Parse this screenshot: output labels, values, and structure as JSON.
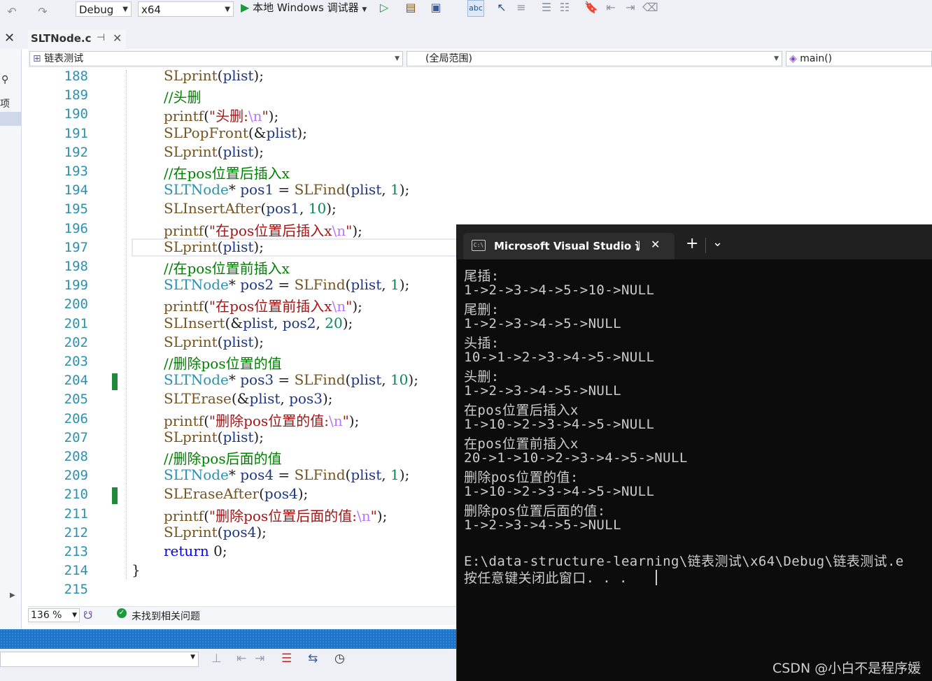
{
  "toolbar": {
    "config": "Debug",
    "platform": "x64",
    "run_label": "本地 Windows 调试器"
  },
  "tab": {
    "file": "SLTNode.c",
    "pin_glyph": "⊣",
    "close_glyph": "✕"
  },
  "side": {
    "close_glyph": "✕",
    "search_glyph": "⚲",
    "text": "项目,"
  },
  "navbar": {
    "project": "链表测试",
    "scope": "(全局范围)",
    "member": "main()"
  },
  "editor": {
    "lines": [
      {
        "num": "188",
        "code": [
          {
            "t": "SLprint",
            "c": "fn"
          },
          {
            "t": "(",
            "c": ""
          },
          {
            "t": "plist",
            "c": "var"
          },
          {
            "t": ");",
            "c": ""
          }
        ]
      },
      {
        "num": "189",
        "code": [
          {
            "t": "//头删",
            "c": "cm"
          }
        ]
      },
      {
        "num": "190",
        "code": [
          {
            "t": "printf",
            "c": "fn"
          },
          {
            "t": "(",
            "c": ""
          },
          {
            "t": "\"头删:",
            "c": "st"
          },
          {
            "t": "\\n",
            "c": "esc"
          },
          {
            "t": "\"",
            "c": "st"
          },
          {
            "t": ");",
            "c": ""
          }
        ]
      },
      {
        "num": "191",
        "code": [
          {
            "t": "SLPopFront",
            "c": "fn"
          },
          {
            "t": "(&",
            "c": ""
          },
          {
            "t": "plist",
            "c": "var"
          },
          {
            "t": ");",
            "c": ""
          }
        ]
      },
      {
        "num": "192",
        "code": [
          {
            "t": "SLprint",
            "c": "fn"
          },
          {
            "t": "(",
            "c": ""
          },
          {
            "t": "plist",
            "c": "var"
          },
          {
            "t": ");",
            "c": ""
          }
        ]
      },
      {
        "num": "193",
        "code": [
          {
            "t": "//在pos位置后插入x",
            "c": "cm"
          }
        ]
      },
      {
        "num": "194",
        "code": [
          {
            "t": "SLTNode",
            "c": "ty"
          },
          {
            "t": "* ",
            "c": ""
          },
          {
            "t": "pos1",
            "c": "var"
          },
          {
            "t": " = ",
            "c": ""
          },
          {
            "t": "SLFind",
            "c": "fn"
          },
          {
            "t": "(",
            "c": ""
          },
          {
            "t": "plist",
            "c": "var"
          },
          {
            "t": ", ",
            "c": ""
          },
          {
            "t": "1",
            "c": "num"
          },
          {
            "t": ");",
            "c": ""
          }
        ]
      },
      {
        "num": "195",
        "code": [
          {
            "t": "SLInsertAfter",
            "c": "fn"
          },
          {
            "t": "(",
            "c": ""
          },
          {
            "t": "pos1",
            "c": "var"
          },
          {
            "t": ", ",
            "c": ""
          },
          {
            "t": "10",
            "c": "num"
          },
          {
            "t": ");",
            "c": ""
          }
        ]
      },
      {
        "num": "196",
        "code": [
          {
            "t": "printf",
            "c": "fn"
          },
          {
            "t": "(",
            "c": ""
          },
          {
            "t": "\"在pos位置后插入x",
            "c": "st"
          },
          {
            "t": "\\n",
            "c": "esc"
          },
          {
            "t": "\"",
            "c": "st"
          },
          {
            "t": ");",
            "c": ""
          }
        ]
      },
      {
        "num": "197",
        "code": [
          {
            "t": "SLprint",
            "c": "fn"
          },
          {
            "t": "(",
            "c": ""
          },
          {
            "t": "plist",
            "c": "var"
          },
          {
            "t": ");",
            "c": ""
          }
        ]
      },
      {
        "num": "198",
        "code": [
          {
            "t": "//在pos位置前插入x",
            "c": "cm"
          }
        ]
      },
      {
        "num": "199",
        "code": [
          {
            "t": "SLTNode",
            "c": "ty"
          },
          {
            "t": "* ",
            "c": ""
          },
          {
            "t": "pos2",
            "c": "var"
          },
          {
            "t": " = ",
            "c": ""
          },
          {
            "t": "SLFind",
            "c": "fn"
          },
          {
            "t": "(",
            "c": ""
          },
          {
            "t": "plist",
            "c": "var"
          },
          {
            "t": ", ",
            "c": ""
          },
          {
            "t": "1",
            "c": "num"
          },
          {
            "t": ");",
            "c": ""
          }
        ]
      },
      {
        "num": "200",
        "code": [
          {
            "t": "printf",
            "c": "fn"
          },
          {
            "t": "(",
            "c": ""
          },
          {
            "t": "\"在pos位置前插入x",
            "c": "st"
          },
          {
            "t": "\\n",
            "c": "esc"
          },
          {
            "t": "\"",
            "c": "st"
          },
          {
            "t": ");",
            "c": ""
          }
        ]
      },
      {
        "num": "201",
        "code": [
          {
            "t": "SLInsert",
            "c": "fn"
          },
          {
            "t": "(&",
            "c": ""
          },
          {
            "t": "plist",
            "c": "var"
          },
          {
            "t": ", ",
            "c": ""
          },
          {
            "t": "pos2",
            "c": "var"
          },
          {
            "t": ", ",
            "c": ""
          },
          {
            "t": "20",
            "c": "num"
          },
          {
            "t": ");",
            "c": ""
          }
        ]
      },
      {
        "num": "202",
        "code": [
          {
            "t": "SLprint",
            "c": "fn"
          },
          {
            "t": "(",
            "c": ""
          },
          {
            "t": "plist",
            "c": "var"
          },
          {
            "t": ");",
            "c": ""
          }
        ]
      },
      {
        "num": "203",
        "code": [
          {
            "t": "//删除pos位置的值",
            "c": "cm"
          }
        ]
      },
      {
        "num": "204",
        "code": [
          {
            "t": "SLTNode",
            "c": "ty"
          },
          {
            "t": "* ",
            "c": ""
          },
          {
            "t": "pos3",
            "c": "var"
          },
          {
            "t": " = ",
            "c": ""
          },
          {
            "t": "SLFind",
            "c": "fn"
          },
          {
            "t": "(",
            "c": ""
          },
          {
            "t": "plist",
            "c": "var"
          },
          {
            "t": ", ",
            "c": ""
          },
          {
            "t": "10",
            "c": "num"
          },
          {
            "t": ");",
            "c": ""
          }
        ]
      },
      {
        "num": "205",
        "code": [
          {
            "t": "SLTErase",
            "c": "fn"
          },
          {
            "t": "(&",
            "c": ""
          },
          {
            "t": "plist",
            "c": "var"
          },
          {
            "t": ", ",
            "c": ""
          },
          {
            "t": "pos3",
            "c": "var"
          },
          {
            "t": ");",
            "c": ""
          }
        ]
      },
      {
        "num": "206",
        "code": [
          {
            "t": "printf",
            "c": "fn"
          },
          {
            "t": "(",
            "c": ""
          },
          {
            "t": "\"删除pos位置的值:",
            "c": "st"
          },
          {
            "t": "\\n",
            "c": "esc"
          },
          {
            "t": "\"",
            "c": "st"
          },
          {
            "t": ");",
            "c": ""
          }
        ]
      },
      {
        "num": "207",
        "code": [
          {
            "t": "SLprint",
            "c": "fn"
          },
          {
            "t": "(",
            "c": ""
          },
          {
            "t": "plist",
            "c": "var"
          },
          {
            "t": ");",
            "c": ""
          }
        ]
      },
      {
        "num": "208",
        "code": [
          {
            "t": "//删除pos后面的值",
            "c": "cm"
          }
        ]
      },
      {
        "num": "209",
        "code": [
          {
            "t": "SLTNode",
            "c": "ty"
          },
          {
            "t": "* ",
            "c": ""
          },
          {
            "t": "pos4",
            "c": "var"
          },
          {
            "t": " = ",
            "c": ""
          },
          {
            "t": "SLFind",
            "c": "fn"
          },
          {
            "t": "(",
            "c": ""
          },
          {
            "t": "plist",
            "c": "var"
          },
          {
            "t": ", ",
            "c": ""
          },
          {
            "t": "1",
            "c": "num"
          },
          {
            "t": ");",
            "c": ""
          }
        ]
      },
      {
        "num": "210",
        "code": [
          {
            "t": "SLEraseAfter",
            "c": "fn"
          },
          {
            "t": "(",
            "c": ""
          },
          {
            "t": "pos4",
            "c": "var"
          },
          {
            "t": ");",
            "c": ""
          }
        ]
      },
      {
        "num": "211",
        "code": [
          {
            "t": "printf",
            "c": "fn"
          },
          {
            "t": "(",
            "c": ""
          },
          {
            "t": "\"删除pos位置后面的值:",
            "c": "st"
          },
          {
            "t": "\\n",
            "c": "esc"
          },
          {
            "t": "\"",
            "c": "st"
          },
          {
            "t": ");",
            "c": ""
          }
        ]
      },
      {
        "num": "212",
        "code": [
          {
            "t": "SLprint",
            "c": "fn"
          },
          {
            "t": "(",
            "c": ""
          },
          {
            "t": "pos4",
            "c": "var"
          },
          {
            "t": ");",
            "c": ""
          }
        ]
      },
      {
        "num": "213",
        "code": [
          {
            "t": "return",
            "c": "kw"
          },
          {
            "t": " 0;",
            "c": ""
          }
        ]
      },
      {
        "num": "214",
        "code": [
          {
            "t": "}",
            "c": ""
          }
        ]
      },
      {
        "num": "215",
        "code": []
      }
    ]
  },
  "status": {
    "zoom": "136 %",
    "issues": "未找到相关问题"
  },
  "console": {
    "title": "Microsoft Visual Studio 调试控",
    "tab_icon": "C:\\",
    "close_glyph": "✕",
    "new_tab_glyph": "+",
    "dropdown_glyph": "⌄",
    "lines": [
      "尾插:",
      "1->2->3->4->5->10->NULL",
      "尾删:",
      "1->2->3->4->5->NULL",
      "头插:",
      "10->1->2->3->4->5->NULL",
      "头删:",
      "1->2->3->4->5->NULL",
      "在pos位置后插入x",
      "1->10->2->3->4->5->NULL",
      "在pos位置前插入x",
      "20->1->10->2->3->4->5->NULL",
      "删除pos位置的值:",
      "1->10->2->3->4->5->NULL",
      "删除pos位置后面的值:",
      "1->2->3->4->5->NULL",
      "",
      "E:\\data-structure-learning\\链表测试\\x64\\Debug\\链表测试.e",
      "按任意键关闭此窗口. . ."
    ]
  },
  "watermark": "CSDN @小白不是程序媛",
  "colors": {
    "accent": "#1b74c9",
    "console_bg": "#0c0c0c",
    "change_marker": "#1f8a3a"
  }
}
